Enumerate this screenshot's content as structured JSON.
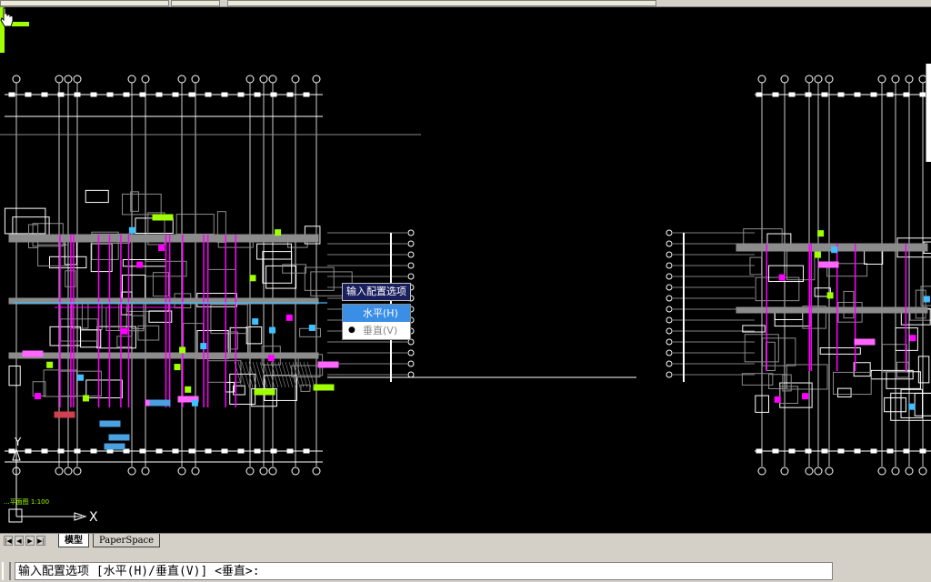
{
  "tabs": [
    {
      "label": "模型",
      "active": true
    },
    {
      "label": "PaperSpace",
      "active": false
    }
  ],
  "nav_buttons": [
    "first",
    "prev",
    "next",
    "last"
  ],
  "dynamic_input": {
    "prompt": "输入配置选项",
    "options": [
      {
        "label": "水平(H)",
        "selected": true,
        "bullet": false
      },
      {
        "label": "垂直(V)",
        "selected": false,
        "bullet": true
      }
    ]
  },
  "command_line": "输入配置选项 [水平(H)/垂直(V)] <垂直>:",
  "ucs": {
    "x_label": "X",
    "y_label": "Y"
  },
  "drawing_title": "...平面图 1:100",
  "colors": {
    "background": "#000000",
    "lines": "#ffffff",
    "gray": "#8c8c8c",
    "magenta": "#ff00ff",
    "green": "#a0ff00",
    "cyan": "#40c0ff",
    "accent": "#3a8ee6"
  }
}
